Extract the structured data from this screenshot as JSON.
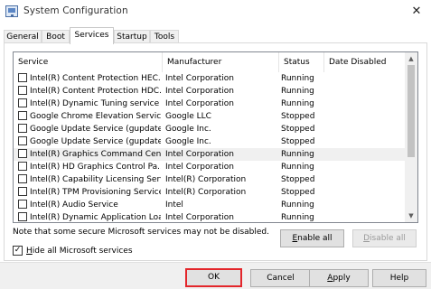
{
  "window": {
    "title": "System Configuration",
    "close_glyph": "✕"
  },
  "tabs": [
    {
      "label": "General",
      "active": false
    },
    {
      "label": "Boot",
      "active": false
    },
    {
      "label": "Services",
      "active": true
    },
    {
      "label": "Startup",
      "active": false
    },
    {
      "label": "Tools",
      "active": false
    }
  ],
  "services": {
    "columns": {
      "service": "Service",
      "manufacturer": "Manufacturer",
      "status": "Status",
      "date_disabled": "Date Disabled"
    },
    "rows": [
      {
        "checked": false,
        "service": "Intel(R) Content Protection HEC...",
        "manufacturer": "Intel Corporation",
        "status": "Running",
        "date_disabled": ""
      },
      {
        "checked": false,
        "service": "Intel(R) Content Protection HDC...",
        "manufacturer": "Intel Corporation",
        "status": "Running",
        "date_disabled": ""
      },
      {
        "checked": false,
        "service": "Intel(R) Dynamic Tuning service",
        "manufacturer": "Intel Corporation",
        "status": "Running",
        "date_disabled": ""
      },
      {
        "checked": false,
        "service": "Google Chrome Elevation Service...",
        "manufacturer": "Google LLC",
        "status": "Stopped",
        "date_disabled": ""
      },
      {
        "checked": false,
        "service": "Google Update Service (gupdate)",
        "manufacturer": "Google Inc.",
        "status": "Stopped",
        "date_disabled": ""
      },
      {
        "checked": false,
        "service": "Google Update Service (gupdatem)",
        "manufacturer": "Google Inc.",
        "status": "Stopped",
        "date_disabled": ""
      },
      {
        "checked": false,
        "service": "Intel(R) Graphics Command Cen...",
        "manufacturer": "Intel Corporation",
        "status": "Running",
        "date_disabled": "",
        "selected": true
      },
      {
        "checked": false,
        "service": "Intel(R) HD Graphics Control Pa...",
        "manufacturer": "Intel Corporation",
        "status": "Running",
        "date_disabled": ""
      },
      {
        "checked": false,
        "service": "Intel(R) Capability Licensing Service...",
        "manufacturer": "Intel(R) Corporation",
        "status": "Stopped",
        "date_disabled": ""
      },
      {
        "checked": false,
        "service": "Intel(R) TPM Provisioning Service",
        "manufacturer": "Intel(R) Corporation",
        "status": "Stopped",
        "date_disabled": ""
      },
      {
        "checked": false,
        "service": "Intel(R) Audio Service",
        "manufacturer": "Intel",
        "status": "Running",
        "date_disabled": ""
      },
      {
        "checked": false,
        "service": "Intel(R) Dynamic Application Loa...",
        "manufacturer": "Intel Corporation",
        "status": "Running",
        "date_disabled": ""
      }
    ]
  },
  "note": "Note that some secure Microsoft services may not be disabled.",
  "buttons": {
    "enable_all": {
      "hotkey": "E",
      "rest": "nable all"
    },
    "disable_all": {
      "hotkey": "D",
      "rest": "isable all"
    },
    "ok": "OK",
    "cancel": "Cancel",
    "apply": {
      "hotkey": "A",
      "rest": "pply"
    },
    "help": "Help"
  },
  "hide_ms": {
    "checked": true,
    "check_glyph": "✓",
    "label_hotkey": "H",
    "label_rest": "ide all Microsoft services"
  },
  "colors": {
    "highlight": "#e3262b",
    "selected_row": "#f0f0f0"
  }
}
